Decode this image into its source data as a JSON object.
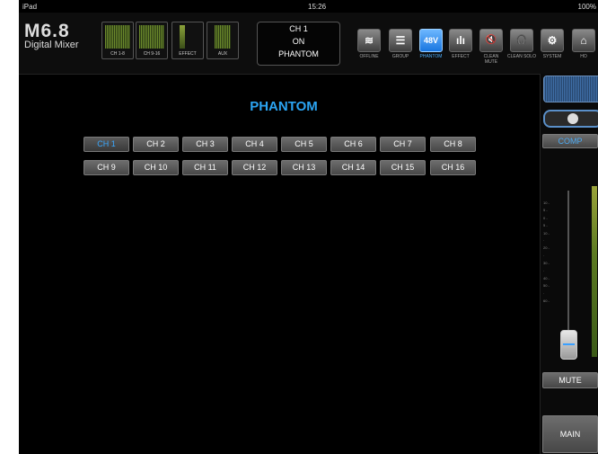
{
  "status_bar": {
    "device": "iPad",
    "time": "15:26",
    "battery": "100%"
  },
  "logo": {
    "model": "M6.8",
    "subtitle": "Digital Mixer"
  },
  "meters": [
    {
      "label": "CH 1-8"
    },
    {
      "label": "CH 9-16"
    },
    {
      "label": "EFFECT"
    },
    {
      "label": "AUX"
    }
  ],
  "display": {
    "line1": "CH 1",
    "line2": "ON",
    "line3": "PHANTOM"
  },
  "toolbar": [
    {
      "label": "OFFLINE",
      "icon": "wifi-icon",
      "glyph": "≋"
    },
    {
      "label": "GROUP",
      "icon": "list-icon",
      "glyph": "☰"
    },
    {
      "label": "PHANTOM",
      "icon": "48v-icon",
      "glyph": "48V",
      "active": true
    },
    {
      "label": "EFFECT",
      "icon": "bars-icon",
      "glyph": "ılı"
    },
    {
      "label": "CLEAN MUTE",
      "icon": "speaker-mute-icon",
      "glyph": "🔇"
    },
    {
      "label": "CLEAN SOLO",
      "icon": "headphones-icon",
      "glyph": "🎧"
    },
    {
      "label": "SYSTEM",
      "icon": "gear-icon",
      "glyph": "⚙"
    },
    {
      "label": "HO",
      "icon": "home-icon",
      "glyph": "⌂"
    }
  ],
  "page": {
    "title": "PHANTOM"
  },
  "channels": [
    "CH 1",
    "CH 2",
    "CH 3",
    "CH 4",
    "CH 5",
    "CH 6",
    "CH 7",
    "CH 8",
    "CH 9",
    "CH 10",
    "CH 11",
    "CH 12",
    "CH 13",
    "CH 14",
    "CH 15",
    "CH 16"
  ],
  "selected_channel": "CH 1",
  "right_panel": {
    "comp_label": "COMP",
    "mute_label": "MUTE",
    "main_label": "MAIN"
  },
  "colors": {
    "accent": "#2ba4f2",
    "background": "#000000"
  }
}
